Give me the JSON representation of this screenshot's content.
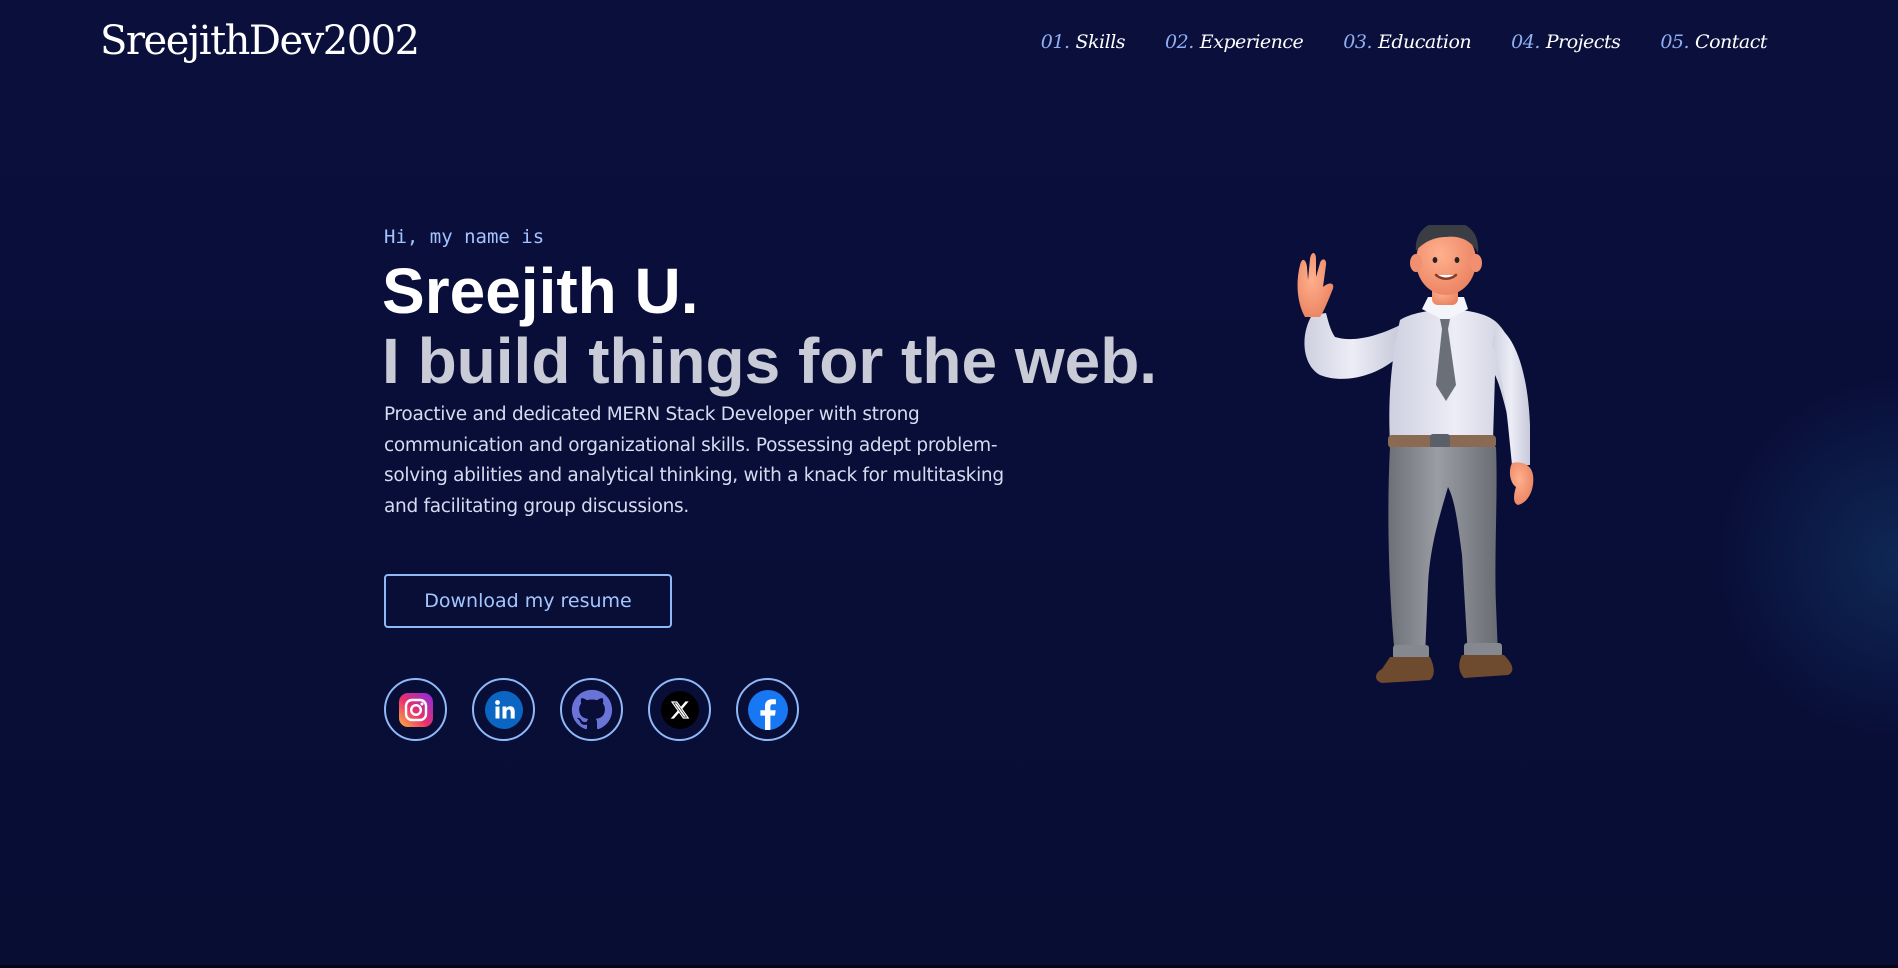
{
  "header": {
    "logo": "SreejithDev2002",
    "nav": [
      {
        "num": "01.",
        "label": "Skills"
      },
      {
        "num": "02.",
        "label": "Experience"
      },
      {
        "num": "03.",
        "label": "Education"
      },
      {
        "num": "04.",
        "label": "Projects"
      },
      {
        "num": "05.",
        "label": "Contact"
      }
    ]
  },
  "hero": {
    "greeting": "Hi, my name is",
    "name": "Sreejith U.",
    "tagline": "I build things for the web.",
    "bio": "Proactive and dedicated MERN Stack Developer with strong communication and organizational skills. Possessing adept problem-solving abilities and analytical thinking, with a knack for multitasking and facilitating group discussions.",
    "resume_button": "Download my resume",
    "socials": [
      {
        "icon": "instagram-icon"
      },
      {
        "icon": "linkedin-icon"
      },
      {
        "icon": "github-icon"
      },
      {
        "icon": "x-twitter-icon"
      },
      {
        "icon": "facebook-icon"
      }
    ]
  },
  "colors": {
    "background": "#0a0f38",
    "accent": "#8fb8f8",
    "nav_number": "#8fb0f4",
    "tagline": "#c9ccd6"
  }
}
